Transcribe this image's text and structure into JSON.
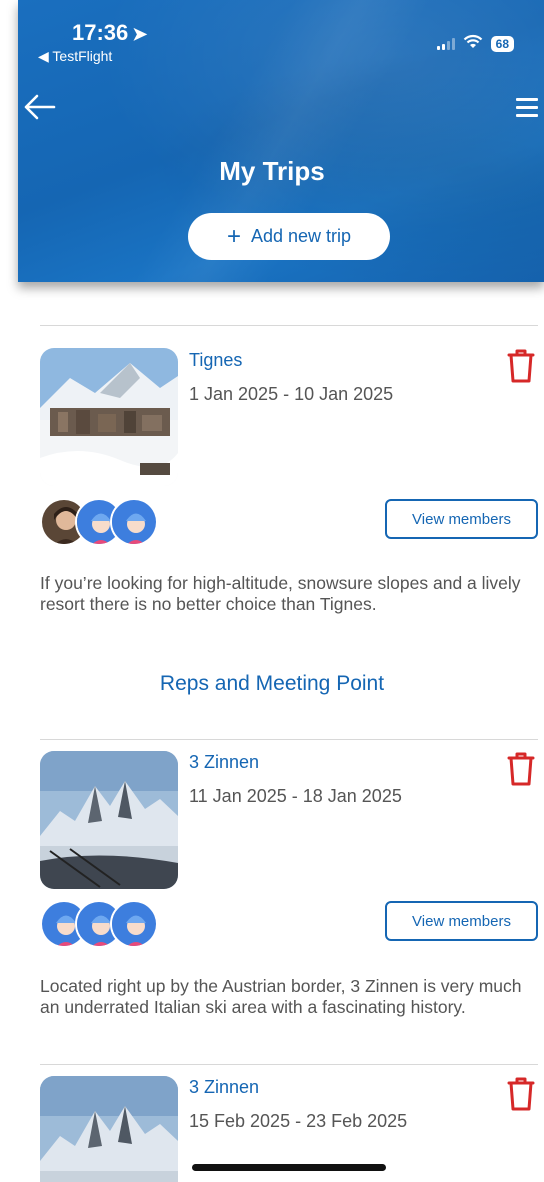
{
  "status_bar": {
    "time": "17:36",
    "back_app": "◀ TestFlight",
    "battery": "68"
  },
  "header": {
    "title": "My Trips",
    "add_trip_label": "Add new trip"
  },
  "trips": [
    {
      "name": "Tignes",
      "dates": "1 Jan 2025 - 10 Jan 2025",
      "view_members_label": "View members",
      "description": "If you’re looking for high-altitude, snowsure slopes and a lively resort there is no better choice than Tignes.",
      "link_label": "Reps and Meeting Point"
    },
    {
      "name": "3 Zinnen",
      "dates": "11 Jan 2025 - 18 Jan 2025",
      "view_members_label": "View members",
      "description": "Located right up by the Austrian border, 3 Zinnen is very much an underrated Italian ski area with a fascinating history."
    },
    {
      "name": "3 Zinnen",
      "dates": "15 Feb 2025 - 23 Feb 2025"
    }
  ],
  "colors": {
    "brand_blue": "#1566b3",
    "trash_red": "#d62828"
  },
  "icons": {
    "back": "arrow-left-icon",
    "menu": "hamburger-menu-icon",
    "add": "plus-icon",
    "delete": "trash-icon",
    "member_default": "default-avatar-icon"
  }
}
